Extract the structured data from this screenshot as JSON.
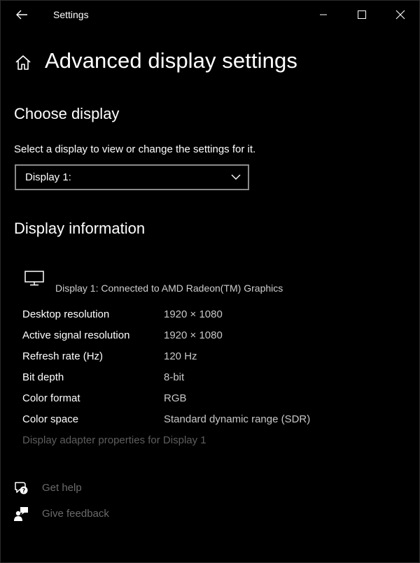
{
  "window": {
    "app_title": "Settings"
  },
  "header": {
    "title": "Advanced display settings"
  },
  "choose_display": {
    "heading": "Choose display",
    "instruction": "Select a display to view or change the settings for it.",
    "selected": "Display 1:"
  },
  "display_info": {
    "heading": "Display information",
    "description": "Display 1: Connected to AMD Radeon(TM) Graphics",
    "rows": [
      {
        "label": "Desktop resolution",
        "value": "1920 × 1080"
      },
      {
        "label": "Active signal resolution",
        "value": "1920 × 1080"
      },
      {
        "label": "Refresh rate (Hz)",
        "value": "120 Hz"
      },
      {
        "label": "Bit depth",
        "value": "8-bit"
      },
      {
        "label": "Color format",
        "value": "RGB"
      },
      {
        "label": "Color space",
        "value": "Standard dynamic range (SDR)"
      }
    ],
    "adapter_link": "Display adapter properties for Display 1"
  },
  "footer": {
    "help": "Get help",
    "feedback": "Give feedback"
  },
  "icons": {
    "back": "back-arrow-icon",
    "minimize": "minimize-icon",
    "maximize": "maximize-icon",
    "close": "close-icon",
    "home": "home-icon",
    "dropdown": "chevron-down-icon",
    "monitor": "monitor-icon",
    "help": "help-icon",
    "feedback": "feedback-icon"
  },
  "colors": {
    "background": "#000000",
    "text": "#ffffff",
    "muted_value": "#c8c8c8",
    "disabled_link": "#5e5e5e",
    "dropdown_border": "#8a8a8a"
  }
}
